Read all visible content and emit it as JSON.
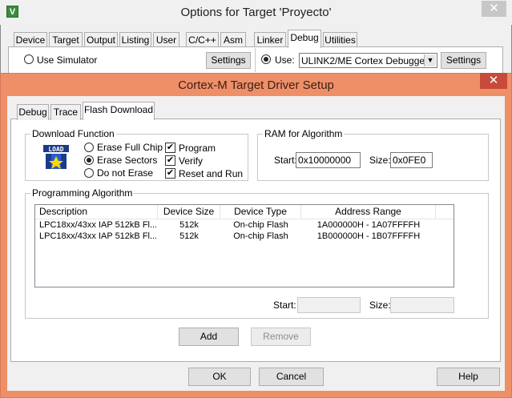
{
  "outer": {
    "title": "Options for Target 'Proyecto'",
    "app_icon": "V",
    "close": "✕",
    "tabs": [
      "Device",
      "Target",
      "Output",
      "Listing",
      "User",
      "C/C++",
      "Asm",
      "Linker",
      "Debug",
      "Utilities"
    ],
    "selected_tab": "Debug",
    "use_simulator": "Use Simulator",
    "settings_left": "Settings",
    "use_label": "Use:",
    "debugger_value": "ULINK2/ME Cortex Debugger",
    "settings_right": "Settings"
  },
  "inner": {
    "title": "Cortex-M Target Driver Setup",
    "close": "✕",
    "tabs": [
      "Debug",
      "Trace",
      "Flash Download"
    ],
    "selected_tab": "Flash Download",
    "download_function": {
      "label": "Download Function",
      "icon_text": "LOAD",
      "radios": [
        "Erase Full Chip",
        "Erase Sectors",
        "Do not Erase"
      ],
      "selected_radio": "Erase Sectors",
      "checks": [
        "Program",
        "Verify",
        "Reset and Run"
      ],
      "check_states": [
        true,
        true,
        true
      ]
    },
    "ram": {
      "label": "RAM for Algorithm",
      "start_label": "Start:",
      "start_value": "0x10000000",
      "size_label": "Size:",
      "size_value": "0x0FE0"
    },
    "programming": {
      "label": "Programming Algorithm",
      "columns": [
        "Description",
        "Device Size",
        "Device Type",
        "Address Range"
      ],
      "rows": [
        [
          "LPC18xx/43xx IAP 512kB Fl...",
          "512k",
          "On-chip Flash",
          "1A000000H - 1A07FFFFH"
        ],
        [
          "LPC18xx/43xx IAP 512kB Fl...",
          "512k",
          "On-chip Flash",
          "1B000000H - 1B07FFFFH"
        ]
      ],
      "start_label": "Start:",
      "start_value": "",
      "size_label": "Size:",
      "size_value": ""
    },
    "add_button": "Add",
    "remove_button": "Remove",
    "ok_button": "OK",
    "cancel_button": "Cancel",
    "help_button": "Help"
  }
}
